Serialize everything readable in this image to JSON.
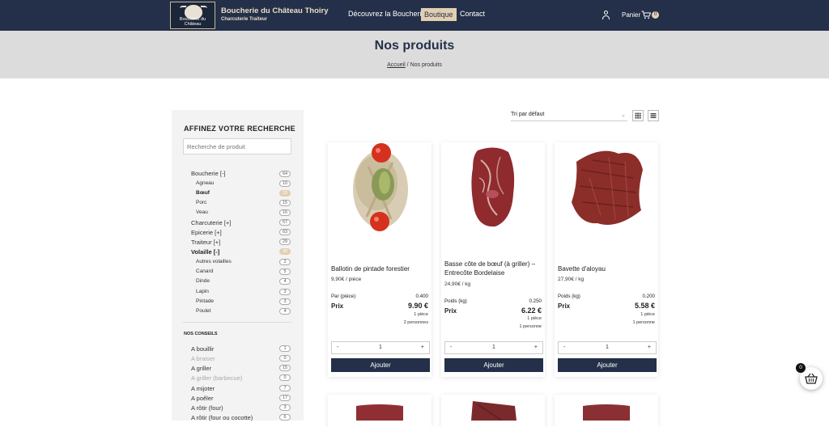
{
  "header": {
    "logo_text": "Boucherie du Château",
    "brand_title": "Boucherie du Château Thoiry",
    "brand_subtitle": "Charcuterie Traiteur",
    "nav": [
      "Découvrez la Boucherie",
      "Boutique",
      "Contact"
    ],
    "cart_label": "Panier",
    "cart_count": "0"
  },
  "hero": {
    "title": "Nos produits",
    "breadcrumb_home": "Accueil",
    "breadcrumb_sep": " / ",
    "breadcrumb_current": "Nos produits"
  },
  "sidebar": {
    "heading": "AFFINEZ VOTRE RECHERCHE",
    "search_placeholder": "Recherche de produit",
    "categories": [
      {
        "label": "Boucherie [-]",
        "count": "64"
      },
      {
        "label": "Agneau",
        "count": "10"
      },
      {
        "label": "Bœuf",
        "count": "23"
      },
      {
        "label": "Porc",
        "count": "15"
      },
      {
        "label": "Veau",
        "count": "16"
      },
      {
        "label": "Charcuterie [+]",
        "count": "57"
      },
      {
        "label": "Epicerie [+]",
        "count": "63"
      },
      {
        "label": "Traiteur [+]",
        "count": "29"
      },
      {
        "label": "Volaille [-]",
        "count": "20"
      },
      {
        "label": "Autres volailles",
        "count": "2"
      },
      {
        "label": "Canard",
        "count": "5"
      },
      {
        "label": "Dinde",
        "count": "4"
      },
      {
        "label": "Lapin",
        "count": "3"
      },
      {
        "label": "Pintade",
        "count": "3"
      },
      {
        "label": "Poulet",
        "count": "4"
      }
    ],
    "conseils_heading": "NOS CONSEILS",
    "conseils": [
      {
        "label": "A bouillir",
        "count": "1"
      },
      {
        "label": "A braiser",
        "count": "0"
      },
      {
        "label": "A griller",
        "count": "15"
      },
      {
        "label": "A griller (barbecue)",
        "count": "0"
      },
      {
        "label": "A mijoter",
        "count": "7"
      },
      {
        "label": "A poêler",
        "count": "17"
      },
      {
        "label": "A rôtir (four)",
        "count": "3"
      },
      {
        "label": "A rôtir (four ou cocotte)",
        "count": "6"
      }
    ]
  },
  "toolbar": {
    "sort_label": "Tri par défaut"
  },
  "products": [
    {
      "name": "Ballotin de pintade forestier",
      "unit_price": "9,90€ / pièce",
      "measure_label": "Par (pièce)",
      "measure_value": "0.400",
      "price_label": "Prix",
      "price": "9.90 €",
      "pieces": "1 pièce",
      "persons": "2 personnes",
      "qty": "1",
      "add_label": "Ajouter"
    },
    {
      "name": "Basse côte de bœuf (à griller) – Entrecôte Bordelaise",
      "unit_price": "24,90€ / kg",
      "measure_label": "Poids (kg)",
      "measure_value": "0.250",
      "price_label": "Prix",
      "price": "6.22 €",
      "pieces": "1 pièce",
      "persons": "1 personne",
      "qty": "1",
      "add_label": "Ajouter"
    },
    {
      "name": "Bavette d'aloyau",
      "unit_price": "27,90€ / kg",
      "measure_label": "Poids (kg)",
      "measure_value": "0.200",
      "price_label": "Prix",
      "price": "5.58 €",
      "pieces": "1 pièce",
      "persons": "1 personne",
      "qty": "1",
      "add_label": "Ajouter"
    }
  ],
  "qty_controls": {
    "minus": "-",
    "plus": "+"
  },
  "floating_cart_count": "0",
  "colors": {
    "header_bg": "#243049",
    "accent": "#e2cfb2",
    "hero_bg": "#dcdcdc",
    "sidebar_bg": "#f3f3f3",
    "button_bg": "#243049"
  }
}
